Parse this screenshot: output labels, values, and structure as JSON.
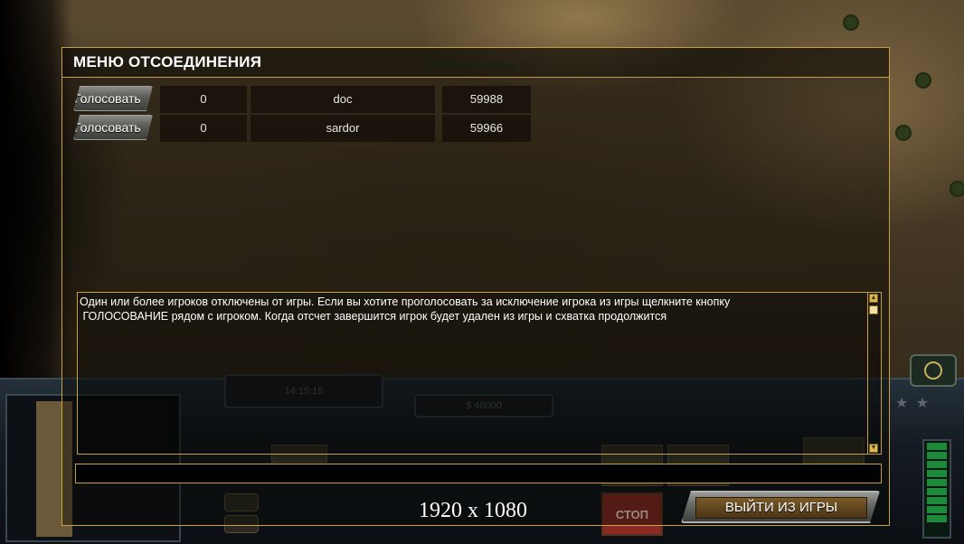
{
  "dialog": {
    "title": "МЕНЮ ОТСОЕДИНЕНИЯ",
    "players": [
      {
        "vote_label": "Голосовать",
        "votes": "0",
        "name": "doc",
        "id": "59988"
      },
      {
        "vote_label": "Голосовать",
        "votes": "0",
        "name": "sardor",
        "id": "59966"
      }
    ],
    "message": "Один или более игроков отключены от игры. Если вы хотите проголосовать за исключение игрока из игры щелкните кнопку\n ГОЛОСОВАНИЕ рядом с игроком. Когда отсчет завершится игрок будет удален из игры и схватка продолжится",
    "chat_value": "",
    "exit_label": "ВЫЙТИ ИЗ ИГРЫ"
  },
  "hud": {
    "timer": "14:15:15",
    "money": "$ 48000",
    "stop_label": "СТОП"
  },
  "overlay": {
    "resolution": "1920 x 1080"
  },
  "colors": {
    "accent": "#c8a040",
    "power": "#1c8a3a"
  }
}
